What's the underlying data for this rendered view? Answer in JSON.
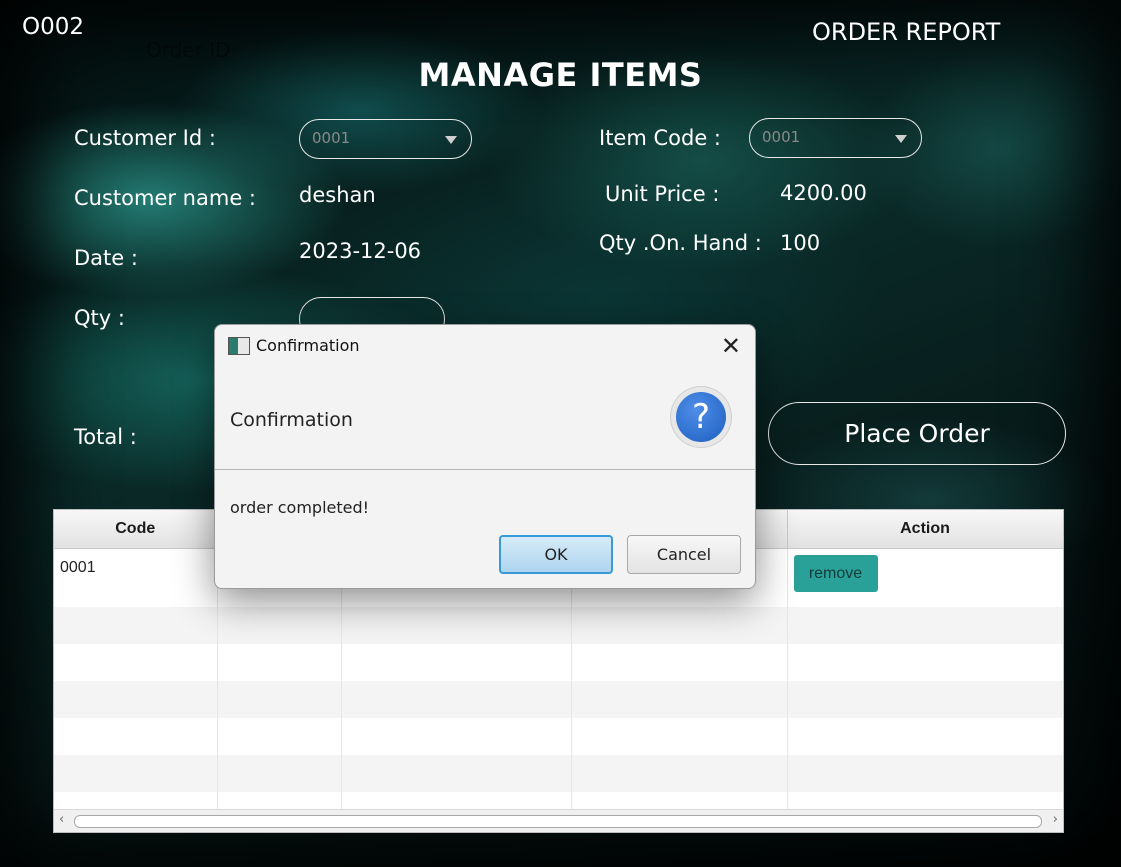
{
  "header": {
    "order_id": "O002",
    "order_id_label": "Order ID",
    "report_link": "ORDER REPORT",
    "title": "MANAGE ITEMS"
  },
  "form": {
    "customer_id_label": "Customer Id :",
    "customer_id_value": "0001",
    "customer_name_label": "Customer name  :",
    "customer_name_value": "deshan",
    "date_label": "Date  :",
    "date_value": "2023-12-06",
    "qty_label": "Qty  :",
    "qty_value": "",
    "total_label": "Total :",
    "item_code_label": "Item Code  :",
    "item_code_value": "0001",
    "unit_price_label": "Unit Price   :",
    "unit_price_value": "4200.00",
    "qty_on_hand_label": "Qty .On. Hand  :",
    "qty_on_hand_value": "100",
    "place_order_label": "Place Order"
  },
  "table": {
    "columns": [
      "Code",
      "",
      "",
      "",
      "Action"
    ],
    "rows": [
      {
        "code": "0001",
        "col2": "",
        "col3": "",
        "col4": "",
        "action": "remove"
      }
    ]
  },
  "dialog": {
    "window_title": "Confirmation",
    "header_text": "Confirmation",
    "content_text": "order completed!",
    "ok_label": "OK",
    "cancel_label": "Cancel",
    "close_glyph": "✕",
    "icon": "question-icon"
  },
  "colors": {
    "remove_button": "#2aa198",
    "ok_border": "#3a9ad9",
    "question_icon": "#2f6fd0"
  }
}
